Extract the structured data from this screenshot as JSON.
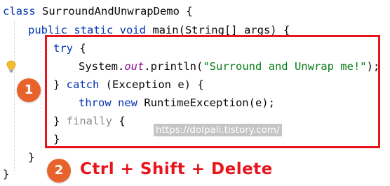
{
  "code": {
    "line1": {
      "kw": "class",
      "rest": " SurroundAndUnwrapDemo {"
    },
    "line2": {
      "kw": "public static void",
      "rest": " main(String[] args) {"
    },
    "line3": {
      "kw": "try",
      "rest": " {"
    },
    "line4": {
      "pre": "System.",
      "field": "out",
      "mid": ".println(",
      "str": "\"Surround and Unwrap me!\"",
      "post": ");"
    },
    "line5": {
      "pre": "} ",
      "kw": "catch",
      "rest": " (Exception e) {"
    },
    "line6": {
      "kw": "throw new",
      "rest": " RuntimeException(e);"
    },
    "line7": {
      "pre": "} ",
      "fin": "finally",
      "rest": " {"
    },
    "line8": {
      "text": "}"
    },
    "line9": {
      "text": "}"
    },
    "line10": {
      "text": "}"
    }
  },
  "annotations": {
    "badge1": "1",
    "badge2": "2",
    "shortcut": "Ctrl + Shift + Delete",
    "watermark": "https://dolpali.tistory.com/"
  },
  "colors": {
    "keyword": "#0033b3",
    "string": "#067d17",
    "field": "#871094",
    "finally_dimmed": "#8c8c8c",
    "highlight_border": "#e8141c",
    "badge": "#e8632b"
  },
  "icons": {
    "intention": "lightbulb-icon"
  }
}
